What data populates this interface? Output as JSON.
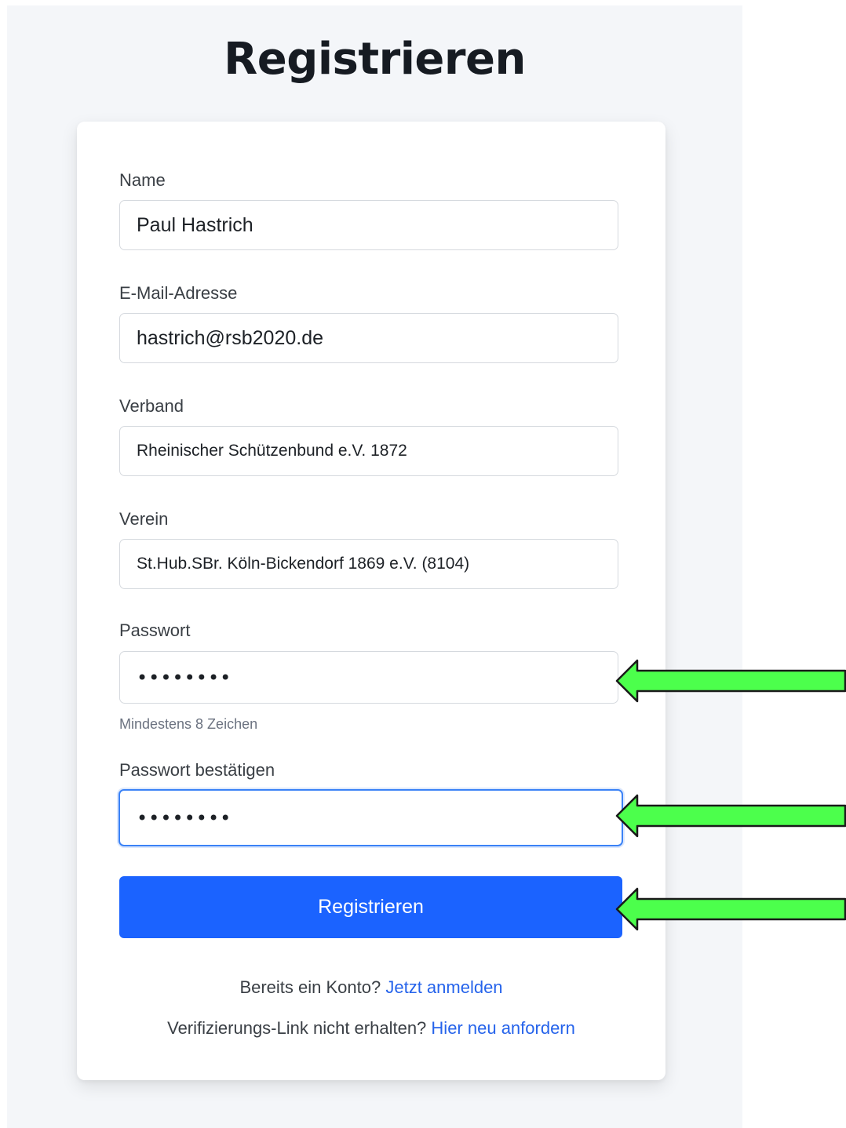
{
  "page_title": "Registrieren",
  "form": {
    "name": {
      "label": "Name",
      "value": "Paul Hastrich"
    },
    "email": {
      "label": "E-Mail-Adresse",
      "value": "hastrich@rsb2020.de"
    },
    "verband": {
      "label": "Verband",
      "value": "Rheinischer Schützenbund e.V. 1872"
    },
    "verein": {
      "label": "Verein",
      "value": "St.Hub.SBr. Köln-Bickendorf 1869 e.V. (8104)"
    },
    "password": {
      "label": "Passwort",
      "value": "••••••••",
      "hint": "Mindestens 8 Zeichen"
    },
    "password_confirm": {
      "label": "Passwort bestätigen",
      "value": "••••••••"
    },
    "submit_label": "Registrieren"
  },
  "footer": {
    "login_prompt": "Bereits ein Konto?",
    "login_link": "Jetzt anmelden",
    "verify_prompt": "Verifizierungs-Link nicht erhalten?",
    "verify_link": "Hier neu anfordern"
  },
  "colors": {
    "accent": "#1b63ff",
    "link": "#2563eb",
    "arrow": "#4cff4c"
  },
  "annotations": [
    "green-arrow-icon",
    "green-arrow-icon",
    "green-arrow-icon"
  ]
}
